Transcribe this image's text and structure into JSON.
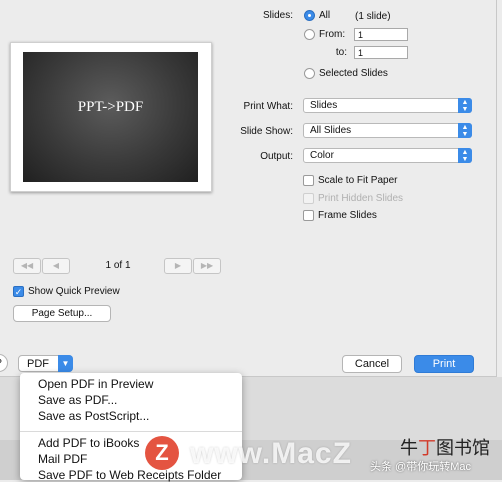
{
  "preview": {
    "slide_title": "PPT->PDF",
    "page_counter": "1 of 1",
    "first_label": "◀◀",
    "prev_label": "◀",
    "next_label": "▶",
    "last_label": "▶▶"
  },
  "options": {
    "show_quick_preview": {
      "label": "Show Quick Preview",
      "checked": true
    },
    "page_setup_label": "Page Setup..."
  },
  "slides": {
    "label": "Slides:",
    "all_label": "All",
    "all_count": "(1 slide)",
    "from_label": "From:",
    "from_value": "1",
    "to_label": "to:",
    "to_value": "1",
    "selected_label": "Selected Slides"
  },
  "print_what": {
    "label": "Print What:",
    "value": "Slides"
  },
  "slide_show": {
    "label": "Slide Show:",
    "value": "All Slides"
  },
  "output": {
    "label": "Output:",
    "value": "Color"
  },
  "checkboxes": {
    "scale": "Scale to Fit Paper",
    "hidden": "Print Hidden Slides",
    "frame": "Frame Slides"
  },
  "footer": {
    "help": "?",
    "pdf_label": "PDF",
    "cancel_label": "Cancel",
    "print_label": "Print"
  },
  "pdf_menu": {
    "items": [
      "Open PDF in Preview",
      "Save as PDF...",
      "Save as PostScript...",
      "Add PDF to iBooks",
      "Mail PDF",
      "Save PDF to Web Receipts Folder"
    ]
  },
  "watermark": {
    "logo_letter": "Z",
    "site": "www.MacZ",
    "brand_plain": "牛",
    "brand_red": "丁",
    "brand_rest": "图书馆",
    "credit": "头条 @带你玩转Mac"
  },
  "colors": {
    "accent": "#3b8be8",
    "dialog_bg": "#ececec"
  }
}
